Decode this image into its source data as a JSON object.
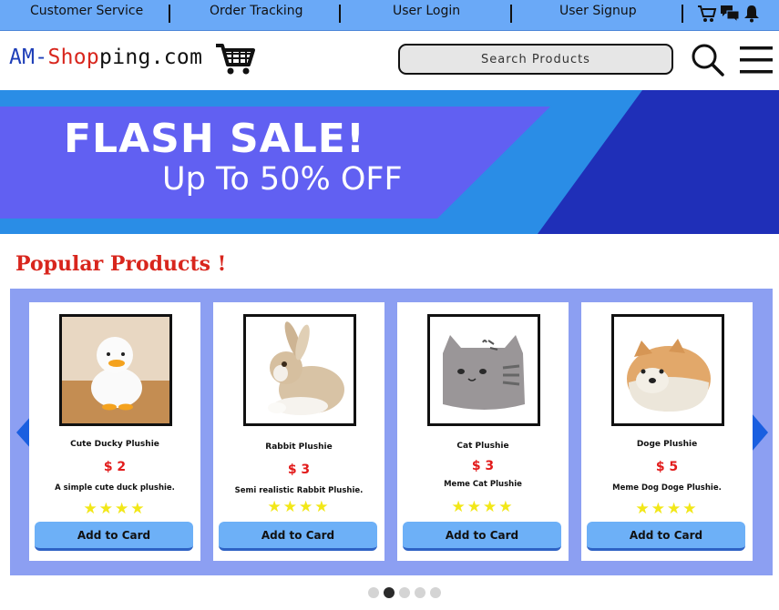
{
  "topbar": {
    "links": [
      "Customer Service",
      "Order Tracking",
      "User Login",
      "User Signup"
    ],
    "icons": [
      "cart-icon",
      "chat-icon",
      "bell-icon"
    ]
  },
  "header": {
    "logo_part1": "AM-",
    "logo_part2": "Shop",
    "logo_part3": "ping.com",
    "search_placeholder": "Search Products",
    "icons": [
      "shopping-cart-icon",
      "search-icon",
      "hamburger-menu-icon"
    ]
  },
  "banner": {
    "line1": "FLASH SALE!",
    "line2": "Up To 50% OFF",
    "colors": {
      "purple": "#6160f2",
      "blue": "#2a8de6",
      "navy": "#1f2fb8"
    }
  },
  "popular": {
    "title": "Popular Products !",
    "products": [
      {
        "name": "Cute Ducky Plushie",
        "price": "$ 2",
        "description": "A simple cute duck plushie.",
        "rating": 4,
        "button": "Add to Card"
      },
      {
        "name": "Rabbit Plushie",
        "price": "$ 3",
        "description": "Semi realistic Rabbit Plushie.",
        "rating": 4,
        "button": "Add to Card"
      },
      {
        "name": "Cat Plushie",
        "price": "$ 3",
        "description": "Meme Cat Plushie",
        "rating": 4,
        "button": "Add to Card"
      },
      {
        "name": "Doge Plushie",
        "price": "$ 5",
        "description": "Meme Dog Doge Plushie.",
        "rating": 4,
        "button": "Add to Card"
      }
    ]
  },
  "pagination": {
    "total": 5,
    "active_index": 1
  },
  "colors": {
    "topbar": "#6aa9f7",
    "accent_red": "#d8261d",
    "carousel_bg": "#8c9ff2",
    "button": "#6db0f7",
    "star": "#f2e718"
  }
}
